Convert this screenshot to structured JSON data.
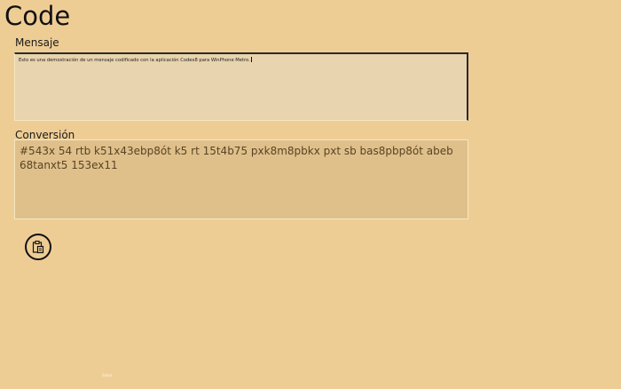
{
  "app": {
    "title": "Code"
  },
  "mensaje": {
    "label": "Mensaje",
    "value": "Esto es una demostración de un mensaje codificado con la aplicación Codex8  para WinPhone Metro."
  },
  "conversion": {
    "label": "Conversión",
    "value": "#543x 54 rtb k51x43ebp8ót k5 rt 15t4b75 pxk8m8pbkx pxt sb bas8pbp8ót  abeb 68tanxt5 153ex11"
  },
  "actions": {
    "paste_icon": "paste-icon"
  },
  "footer": {
    "text": "Sobre"
  },
  "colors": {
    "background": "#eecd95",
    "mensaje_box": "#e8d4ae",
    "conversion_box": "#dfc08b",
    "conversion_text": "#5a4424"
  }
}
